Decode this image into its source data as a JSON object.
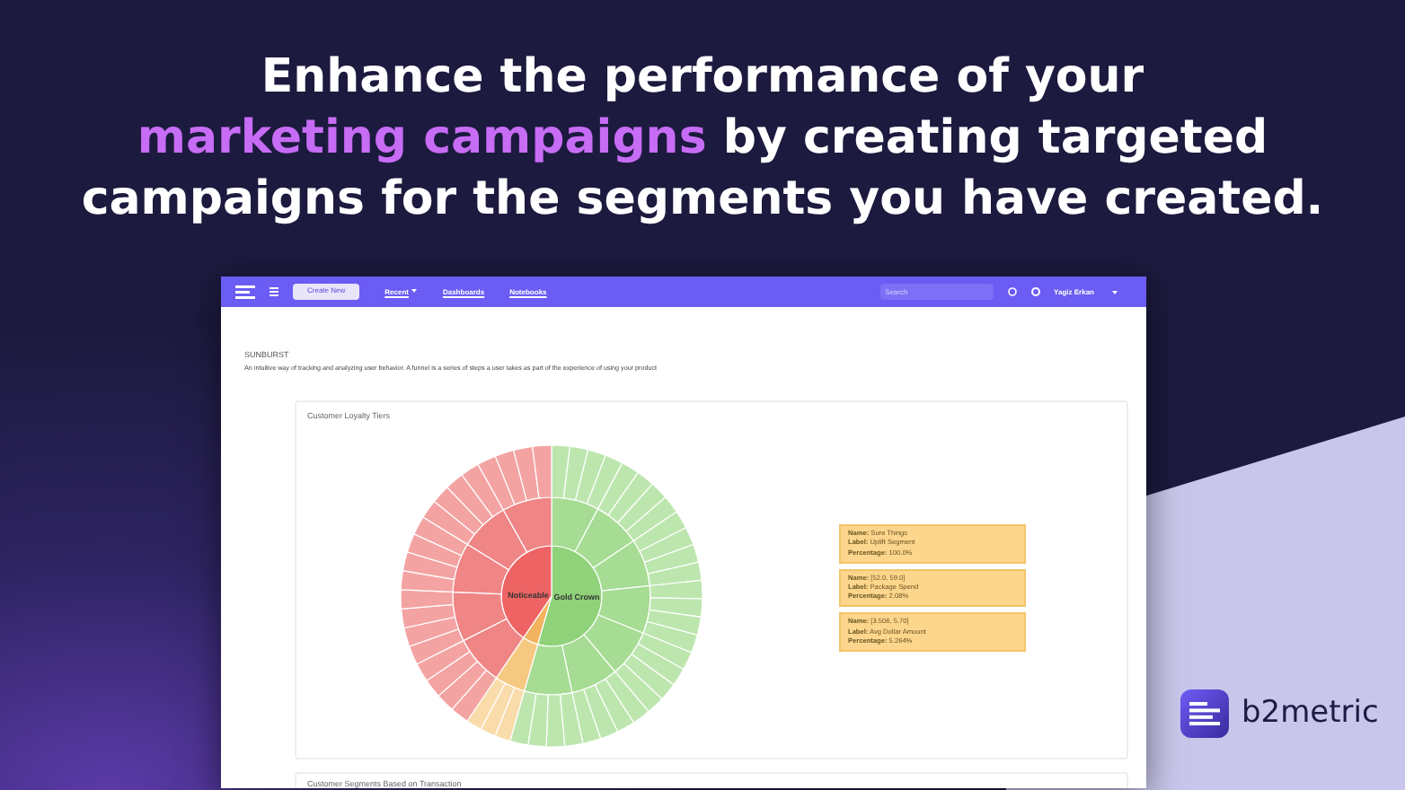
{
  "headline": [
    {
      "text": "Enhance the performance of your",
      "highlight": false
    },
    {
      "text": "marketing campaigns",
      "highlight": true
    },
    {
      "text": " by creating targeted",
      "highlight": false
    },
    {
      "text": "campaigns for the segments you have created.",
      "highlight": false
    }
  ],
  "app": {
    "navbar": {
      "create_button": "Create New",
      "menu": [
        {
          "label": "Recent",
          "dropdown": true
        },
        {
          "label": "Dashboards",
          "dropdown": false
        },
        {
          "label": "Notebooks",
          "dropdown": false
        }
      ],
      "search": {
        "placeholder": "Search"
      },
      "user": "Yagiz Erkan"
    },
    "section": {
      "title": "SUNBURST",
      "description": "An intuitive way of tracking and analyzing user behavior. A funnel is a series of steps a user takes as part of the experience of using your product"
    },
    "card": {
      "title": "Customer Loyalty Tiers",
      "center_labels": [
        "Noticeable",
        "Gold Crown"
      ],
      "tooltips": [
        {
          "lines": [
            "**Name:** Sure Things",
            "**Label:** Uplift Segment",
            "**Percentage:** 100.0%"
          ]
        },
        {
          "lines": [
            "**Name:** [52.0, 59.0]",
            "**Label:** Package Spend",
            "**Percentage:** 2.08%"
          ]
        },
        {
          "lines": [
            "**Name:** [3.506, 5.70]",
            "**Label:** Avg Dollar Amount",
            "**Percentage:** 5.264%"
          ]
        }
      ]
    },
    "next_card": {
      "title": "Customer Segments Based on Transaction"
    }
  },
  "brand": {
    "name": "b2metric"
  }
}
